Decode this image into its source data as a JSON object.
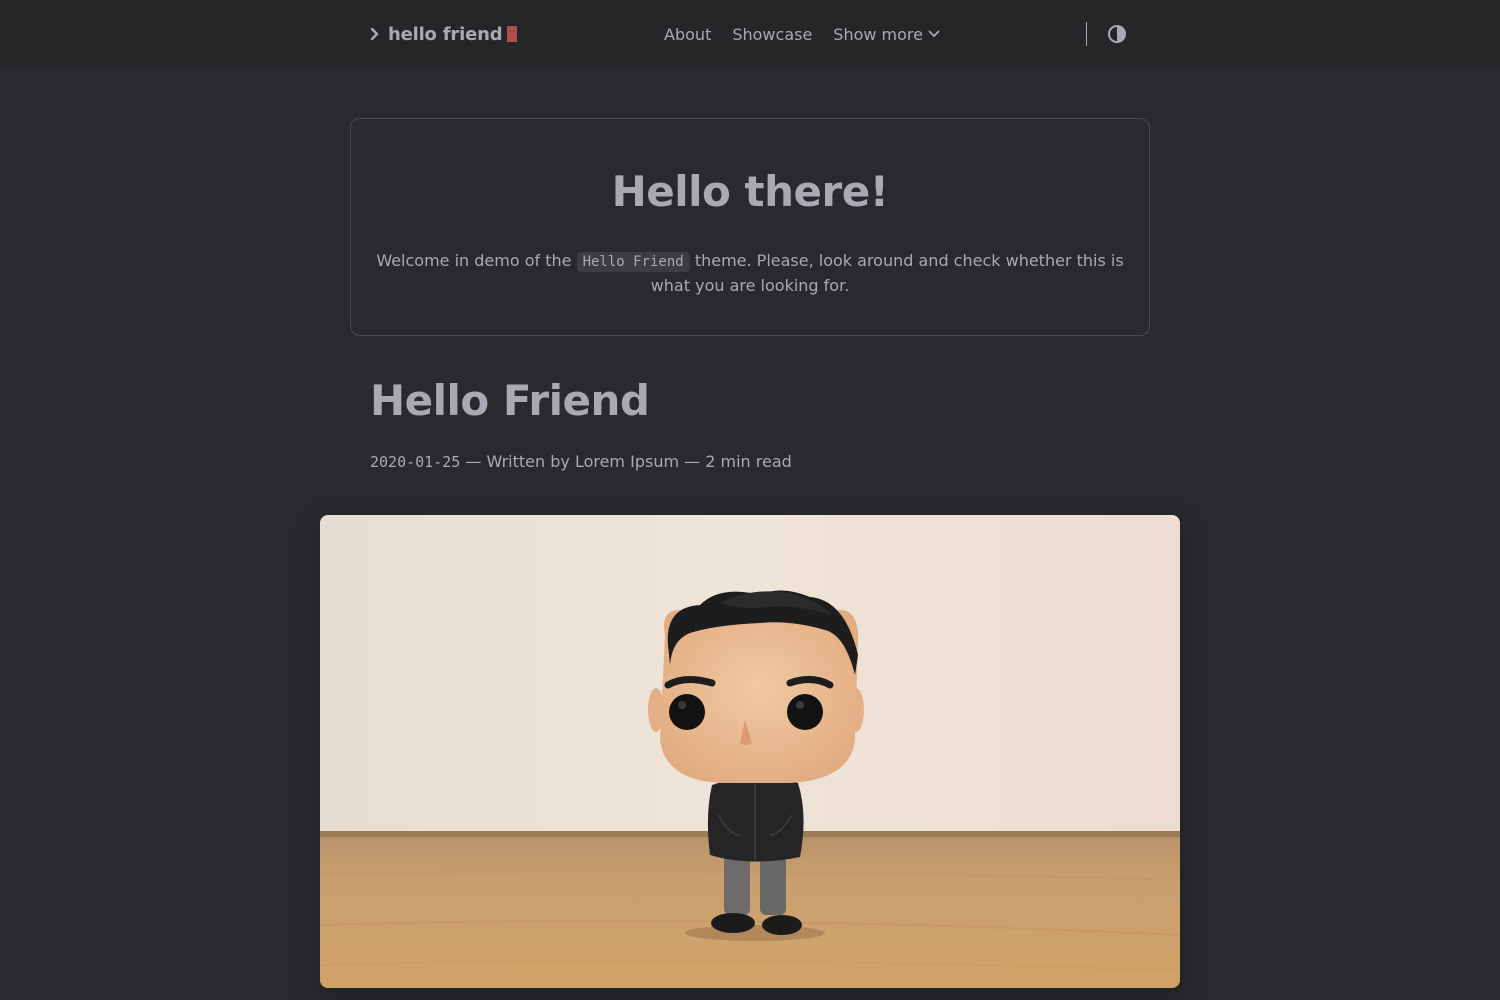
{
  "header": {
    "logo_text": "hello friend",
    "nav": [
      {
        "label": "About"
      },
      {
        "label": "Showcase"
      },
      {
        "label": "Show more"
      }
    ]
  },
  "hero": {
    "title": "Hello there!",
    "text_before": "Welcome in demo of the ",
    "code": "Hello Friend",
    "text_after": " theme. Please, look around and check whether this is what you are looking for."
  },
  "post": {
    "title": "Hello Friend",
    "date": "2020-01-25",
    "author_text": " — Written by Lorem Ipsum — ",
    "read_time": "2 min read"
  },
  "colors": {
    "background": "#292a2d",
    "header_background": "#252627",
    "text": "#a9a9b3",
    "accent": "#e0585c"
  },
  "icons": {
    "logo": "chevron-right-icon",
    "show_more": "chevron-down-icon",
    "theme_toggle": "half-circle-contrast-icon"
  }
}
